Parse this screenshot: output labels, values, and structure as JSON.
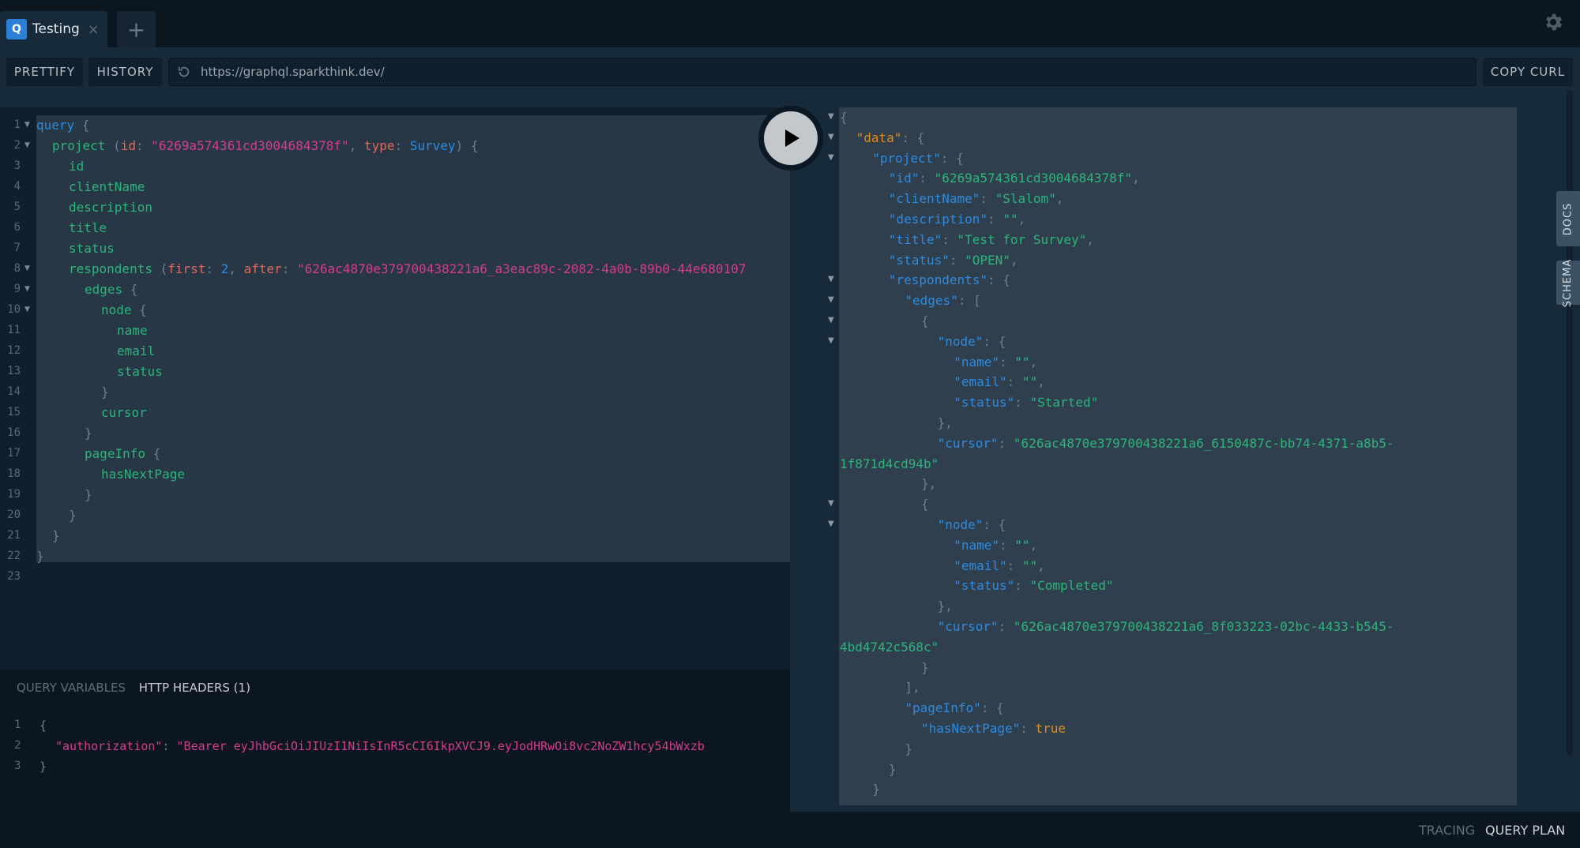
{
  "tabs": [
    {
      "icon": "Q",
      "title": "Testing",
      "close": "×"
    }
  ],
  "new_tab": "+",
  "toolbar": {
    "prettify": "PRETTIFY",
    "history": "HISTORY",
    "url": "https://graphql.sparkthink.dev/",
    "copy_curl": "COPY CURL"
  },
  "query_editor": {
    "line_numbers": [
      "1",
      "2",
      "3",
      "4",
      "5",
      "6",
      "7",
      "8",
      "9",
      "10",
      "11",
      "12",
      "13",
      "14",
      "15",
      "16",
      "17",
      "18",
      "19",
      "20",
      "21",
      "22",
      "23"
    ],
    "lines": {
      "l1_kw": "query",
      "l1_brace": " {",
      "l2_field": "project",
      "l2_open": " (",
      "l2_arg": "id",
      "l2_colon": ": ",
      "l2_str": "\"6269a574361cd3004684378f\"",
      "l2_comma": ", ",
      "l2_arg2": "type",
      "l2_colon2": ": ",
      "l2_type": "Survey",
      "l2_close": ") {",
      "l3": "id",
      "l4": "clientName",
      "l5": "description",
      "l6": "title",
      "l7": "status",
      "l8_field": "respondents",
      "l8_open": " (",
      "l8_arg": "first",
      "l8_colon": ": ",
      "l8_num": "2",
      "l8_comma": ", ",
      "l8_arg2": "after",
      "l8_colon2": ": ",
      "l8_str": "\"626ac4870e379700438221a6_a3eac89c-2082-4a0b-89b0-44e680107",
      "l9": "edges",
      "l9_brace": " {",
      "l10": "node",
      "l10_brace": " {",
      "l11": "name",
      "l12": "email",
      "l13": "status",
      "l14": "}",
      "l15": "cursor",
      "l16": "}",
      "l17": "pageInfo",
      "l17_brace": " {",
      "l18": "hasNextPage",
      "l19": "}",
      "l20": "}",
      "l21": "}",
      "l22": "}"
    }
  },
  "variables_pane": {
    "tabs": [
      "QUERY VARIABLES",
      "HTTP HEADERS (1)"
    ],
    "active_tab": "HTTP HEADERS (1)",
    "line_numbers": [
      "1",
      "2",
      "3"
    ],
    "l1": "{",
    "l2_key": "\"authorization\"",
    "l2_colon": ": ",
    "l2_val": "\"Bearer eyJhbGciOiJIUzI1NiIsInR5cCI6IkpXVCJ9.eyJodHRwOi8vc2NoZW1hcy54bWxzb",
    "l3": "}"
  },
  "response": {
    "data_key": "\"data\"",
    "project_key": "\"project\"",
    "fields": {
      "id": "\"6269a574361cd3004684378f\"",
      "clientName": "\"Slalom\"",
      "description": "\"\"",
      "title": "\"Test for Survey\"",
      "status": "\"OPEN\""
    },
    "edges": [
      {
        "name": "\"\"",
        "email": "\"\"",
        "status": "\"Started\"",
        "cursor_a": "\"626ac4870e379700438221a6_6150487c-bb74-4371-a8b5-",
        "cursor_b": "1f871d4cd94b\""
      },
      {
        "name": "\"\"",
        "email": "\"\"",
        "status": "\"Completed\"",
        "cursor_a": "\"626ac4870e379700438221a6_8f033223-02bc-4433-b545-",
        "cursor_b": "4bd4742c568c\""
      }
    ],
    "hasNextPage": "true",
    "keys": {
      "id": "\"id\"",
      "clientName": "\"clientName\"",
      "description": "\"description\"",
      "title": "\"title\"",
      "status": "\"status\"",
      "respondents": "\"respondents\"",
      "edges": "\"edges\"",
      "node": "\"node\"",
      "name": "\"name\"",
      "email": "\"email\"",
      "cursor": "\"cursor\"",
      "pageInfo": "\"pageInfo\"",
      "hasNextPage": "\"hasNextPage\""
    }
  },
  "side_tabs": [
    "DOCS",
    "SCHEMA"
  ],
  "footer": {
    "tracing": "TRACING",
    "query_plan": "QUERY PLAN"
  },
  "colors": {
    "accent": "#2b7fd6",
    "field": "#2cb47b",
    "string": "#d63d8b",
    "keyword": "#2d8be0",
    "argument": "#e0685b",
    "boolean": "#e28c1c"
  }
}
